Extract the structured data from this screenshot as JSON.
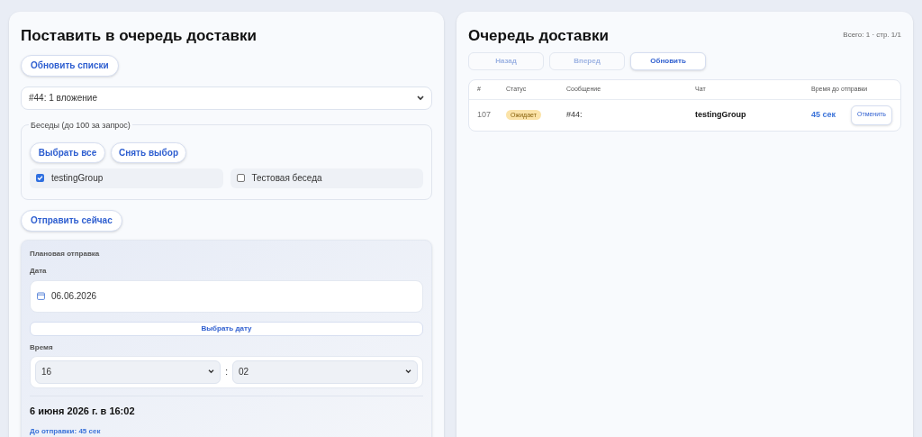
{
  "enqueue": {
    "title": "Поставить в очередь доставки",
    "refresh_button": "Обновить списки",
    "message_select": "#44: 1 вложение",
    "chats": {
      "legend": "Беседы (до 100 за запрос)",
      "select_all": "Выбрать все",
      "clear": "Снять выбор",
      "items": [
        {
          "label": "testingGroup",
          "checked": true
        },
        {
          "label": "Тестовая беседа",
          "checked": false
        }
      ]
    },
    "send_now": "Отправить сейчас",
    "schedule": {
      "title": "Плановая отправка",
      "date_label": "Дата",
      "date": "06.06.2026",
      "pick_date": "Выбрать дату",
      "time_label": "Время",
      "hour": "16",
      "separator": ":",
      "minute": "02",
      "summary": "6 июня 2026 г. в 16:02",
      "countdown": "До отправки: 45 сек"
    }
  },
  "queue": {
    "title": "Очередь доставки",
    "total": "Всего: 1 · стр. 1/1",
    "buttons": [
      {
        "label": "Назад",
        "disabled": true
      },
      {
        "label": "Вперед",
        "disabled": true
      },
      {
        "label": "Обновить",
        "disabled": false
      }
    ],
    "columns": [
      "#",
      "Статус",
      "Сообщение",
      "Чат",
      "Время до отправки"
    ],
    "rows": [
      {
        "id": "107",
        "status": "Ожидает",
        "message": "#44:",
        "chat": "testingGroup",
        "eta": "45 сек",
        "action": "Отменить"
      }
    ]
  }
}
